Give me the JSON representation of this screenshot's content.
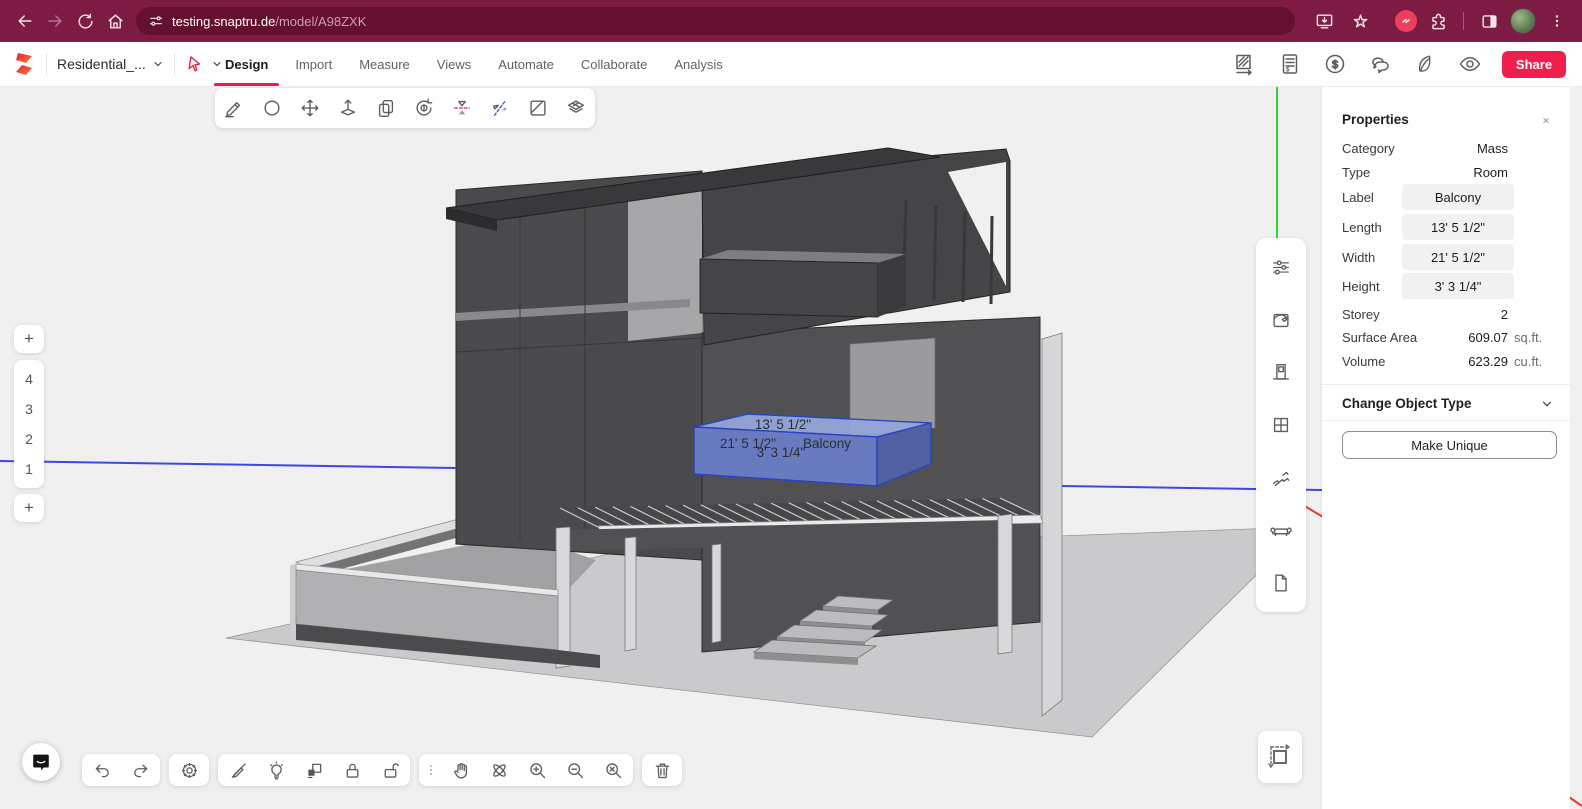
{
  "browser": {
    "url_host": "testing.snaptru.de",
    "url_path": "/model/A98ZXK"
  },
  "header": {
    "project_name": "Residential_...",
    "menu": [
      {
        "label": "Design",
        "active": true
      },
      {
        "label": "Import",
        "active": false
      },
      {
        "label": "Measure",
        "active": false
      },
      {
        "label": "Views",
        "active": false
      },
      {
        "label": "Automate",
        "active": false
      },
      {
        "label": "Collaborate",
        "active": false
      },
      {
        "label": "Analysis",
        "active": false
      }
    ],
    "share_label": "Share"
  },
  "icons": {
    "currency": "$"
  },
  "storeys": {
    "add_top": "+",
    "items": [
      "4",
      "3",
      "2",
      "1"
    ],
    "add_bottom": "+"
  },
  "viewport": {
    "selected_object": "Balcony",
    "dim_length": "13' 5 1/2\"",
    "dim_width": "21' 5 1/2\"",
    "dim_height": "3' 3 1/4\"",
    "axis_colors": {
      "x": "#e8392f",
      "y": "#35d435",
      "z": "#3b47e8"
    },
    "selection_color": "#2742c9"
  },
  "properties": {
    "title": "Properties",
    "rows_static": [
      {
        "label": "Category",
        "value": "Mass"
      },
      {
        "label": "Type",
        "value": "Room"
      }
    ],
    "rows_input": [
      {
        "label": "Label",
        "value": "Balcony"
      },
      {
        "label": "Length",
        "value": "13' 5 1/2\""
      },
      {
        "label": "Width",
        "value": "21' 5 1/2\""
      },
      {
        "label": "Height",
        "value": "3' 3 1/4\""
      }
    ],
    "rows_readonly": [
      {
        "label": "Storey",
        "value": "2",
        "unit": ""
      },
      {
        "label": "Surface Area",
        "value": "609.07",
        "unit": "sq.ft."
      },
      {
        "label": "Volume",
        "value": "623.29",
        "unit": "cu.ft."
      }
    ],
    "change_object_type": "Change Object Type",
    "make_unique": "Make Unique"
  },
  "colors": {
    "browser_chrome": "#7d1b43",
    "accent_red": "#ef1e4d",
    "canvas_bg": "#f0f0f1"
  }
}
